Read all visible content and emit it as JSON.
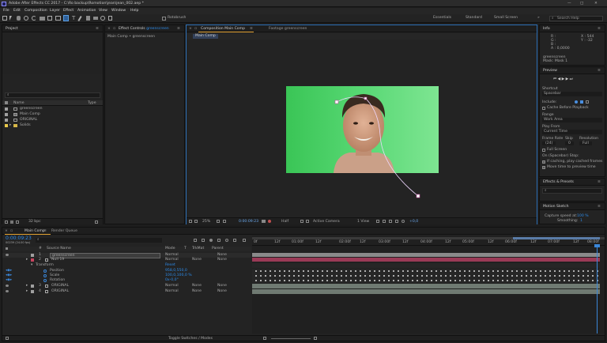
{
  "titlebar": {
    "title": "Adobe After Effects CC 2017 - C:\\Ro backup\\Romotion\\jean\\jean_002.aep *",
    "min": "—",
    "max": "□",
    "close": "✕"
  },
  "menu": [
    "File",
    "Edit",
    "Composition",
    "Layer",
    "Effect",
    "Animation",
    "View",
    "Window",
    "Help"
  ],
  "toolbar": {
    "rotobrush_label": "Rotobrush",
    "workspaces": [
      "Essentials",
      "Standard",
      "Small Screen"
    ],
    "search_placeholder": "Search Help"
  },
  "project": {
    "tab": "Project",
    "search_placeholder": "⌕",
    "col_name": "Name",
    "col_type": "Type",
    "items": [
      {
        "name": "greenscreen",
        "color": "#a0a0a0"
      },
      {
        "name": "Main Comp",
        "color": "#a0a0a0"
      },
      {
        "name": "ORIGINAL",
        "color": "#a0a0a0"
      },
      {
        "name": "Solids",
        "color": "#e8c84a"
      }
    ],
    "bpc": "32 bpc"
  },
  "effect_controls": {
    "tab_prefix": "Effect Controls",
    "tab_layer": "greenscreen",
    "header": "Main Comp • greenscreen"
  },
  "composition": {
    "tab": "Composition Main Comp",
    "footage_tab": "Footage greenscreen",
    "sub_tab": "Main Comp",
    "zoom": "25%",
    "timecode": "0:00:09:23",
    "resolution": "Half",
    "camera": "Active Camera",
    "view": "1 View",
    "exposure": "+0,0"
  },
  "info": {
    "tab": "Info",
    "r": "R :",
    "g": "G :",
    "b": "B :",
    "a": "A : 0,0000",
    "x": "X : 544",
    "y": "Y : -32",
    "layer_name": "greenscreen",
    "mask": "Mask: Mask 1"
  },
  "preview": {
    "tab": "Preview",
    "shortcut_label": "Shortcut",
    "shortcut": "Spacebar",
    "include_label": "Include:",
    "cache": "Cache Before Playback",
    "range_label": "Range",
    "range": "Work Area",
    "play_from_label": "Play From",
    "play_from": "Current Time",
    "frame_rate_label": "Frame Rate",
    "skip_label": "Skip",
    "resolution_label": "Resolution",
    "frame_rate": "(24)",
    "skip": "0",
    "resolution": "Full",
    "full_screen": "Full Screen",
    "on_stop": "On (Spacebar) Stop:",
    "if_caching": "If caching, play cached frames",
    "move_time": "Move time to preview time"
  },
  "effects_presets": {
    "tab": "Effects & Presets",
    "search_placeholder": "⌕"
  },
  "motion_sketch": {
    "tab": "Motion Sketch",
    "capture_label": "Capture speed at:",
    "capture_value": "100 %",
    "smoothing_label": "Smoothing:",
    "smoothing_value": "1"
  },
  "timeline": {
    "tab": "Main Comp",
    "render_tab": "Render Queue",
    "timecode": "0:00:09:23",
    "frame_info": "00239 (24.00 fps)",
    "search_placeholder": "⌕",
    "col_num": "#",
    "col_source": "Source Name",
    "col_mode": "Mode",
    "col_t": "T",
    "col_trkmat": "TrkMat",
    "col_parent": "Parent",
    "layers": [
      {
        "num": "1",
        "name": "greenscreen",
        "mode": "Normal",
        "trk": "",
        "parent": "None"
      },
      {
        "num": "2",
        "name": "Null 19",
        "mode": "Normal",
        "trk": "None",
        "parent": "None"
      }
    ],
    "transform": "Transform",
    "reset": "Reset",
    "props": [
      {
        "name": "Position",
        "value": "958,0,550,0"
      },
      {
        "name": "Scale",
        "value": "100,0,100,0 %"
      },
      {
        "name": "Rotation",
        "value": "0x-0,0°"
      }
    ],
    "layers2": [
      {
        "num": "3",
        "name": "ORIGINAL",
        "mode": "Normal",
        "trk": "None",
        "parent": "None"
      },
      {
        "num": "4",
        "name": "ORIGINAL",
        "mode": "Normal",
        "trk": "None",
        "parent": "None"
      }
    ],
    "ruler": [
      "0f",
      "12f",
      "01:00f",
      "12f",
      "02:00f",
      "12f",
      "03:00f",
      "12f",
      "04:00f",
      "12f",
      "05:00f",
      "12f",
      "06:00f",
      "12f",
      "07:00f",
      "12f",
      "08:00f",
      "12f",
      "09:00f",
      "12f",
      "10:0"
    ],
    "toggle_label": "Toggle Switches / Modes"
  }
}
